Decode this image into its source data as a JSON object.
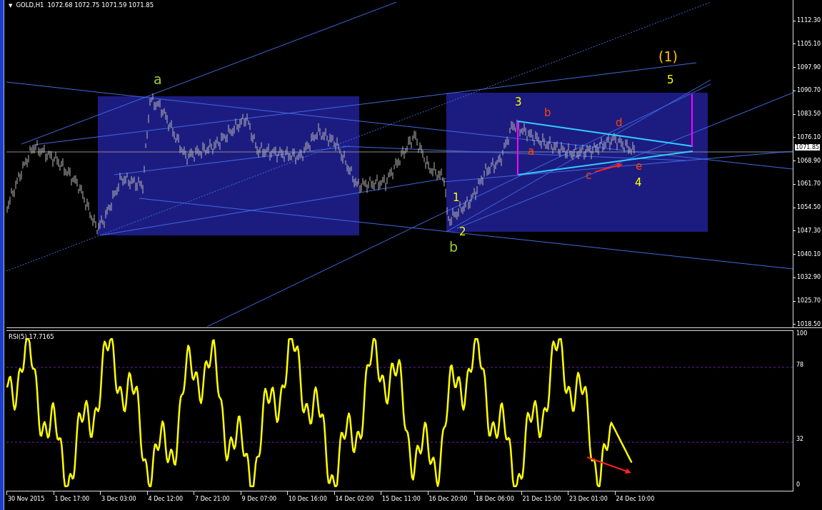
{
  "chart_header": {
    "menu_glyph": "▼",
    "symbol": "GOLD,H1",
    "ohlc": [
      "1072.68",
      "1072.75",
      "1071.59",
      "1071.85"
    ]
  },
  "price_axis": {
    "labels": [
      "1112.30",
      "1105.10",
      "1097.90",
      "1090.70",
      "1083.50",
      "1076.10",
      "1068.90",
      "1061.70",
      "1054.50",
      "1047.30",
      "1040.10",
      "1032.90",
      "1025.70",
      "1018.50"
    ],
    "current_price": "1071.85"
  },
  "wave_labels": [
    {
      "text": "a",
      "color": "#9acd32"
    },
    {
      "text": "b",
      "color": "#9acd32"
    },
    {
      "text": "1",
      "color": "#ffff00"
    },
    {
      "text": "2",
      "color": "#ffff00"
    },
    {
      "text": "3",
      "color": "#ffff00"
    },
    {
      "text": "b",
      "color": "#ff4500"
    },
    {
      "text": "a",
      "color": "#ff4500"
    },
    {
      "text": "c",
      "color": "#ff4500"
    },
    {
      "text": "d",
      "color": "#ff4500"
    },
    {
      "text": "e",
      "color": "#ff4500"
    },
    {
      "text": "4",
      "color": "#ffff00"
    },
    {
      "text": "5",
      "color": "#ffff00"
    },
    {
      "text": "(1)",
      "color": "#ffc000"
    }
  ],
  "rsi_panel": {
    "title": "RSI(5) 17.7165",
    "axis_labels": [
      "100",
      "78",
      "32",
      "0"
    ]
  },
  "time_axis": {
    "labels": [
      "30 Nov 2015",
      "1 Dec 17:00",
      "3 Dec 03:00",
      "4 Dec 12:00",
      "7 Dec 21:00",
      "9 Dec 07:00",
      "10 Dec 16:00",
      "14 Dec 02:00",
      "15 Dec 11:00",
      "16 Dec 20:00",
      "18 Dec 06:00",
      "21 Dec 15:00",
      "23 Dec 01:00",
      "24 Dec 10:00"
    ]
  }
}
